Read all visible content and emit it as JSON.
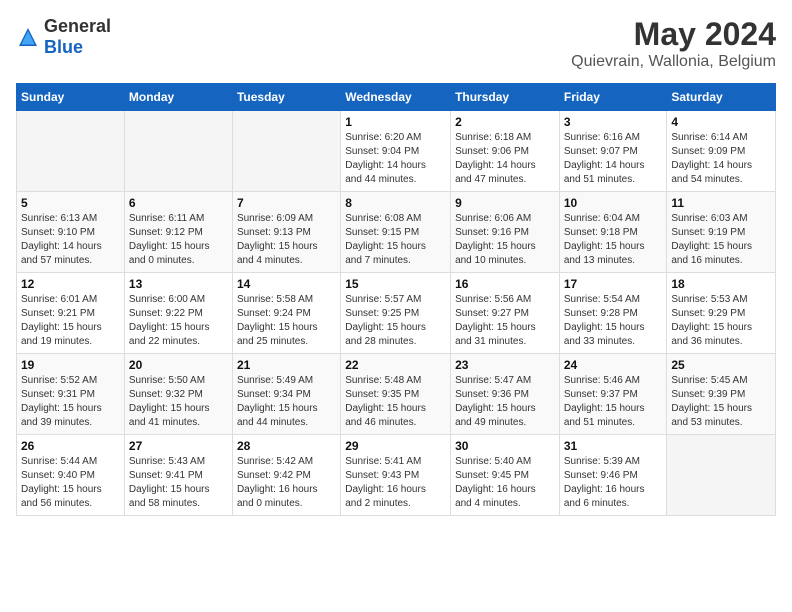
{
  "header": {
    "logo_general": "General",
    "logo_blue": "Blue",
    "title": "May 2024",
    "subtitle": "Quievrain, Wallonia, Belgium"
  },
  "calendar": {
    "days_of_week": [
      "Sunday",
      "Monday",
      "Tuesday",
      "Wednesday",
      "Thursday",
      "Friday",
      "Saturday"
    ],
    "weeks": [
      [
        {
          "day": "",
          "info": ""
        },
        {
          "day": "",
          "info": ""
        },
        {
          "day": "",
          "info": ""
        },
        {
          "day": "1",
          "info": "Sunrise: 6:20 AM\nSunset: 9:04 PM\nDaylight: 14 hours\nand 44 minutes."
        },
        {
          "day": "2",
          "info": "Sunrise: 6:18 AM\nSunset: 9:06 PM\nDaylight: 14 hours\nand 47 minutes."
        },
        {
          "day": "3",
          "info": "Sunrise: 6:16 AM\nSunset: 9:07 PM\nDaylight: 14 hours\nand 51 minutes."
        },
        {
          "day": "4",
          "info": "Sunrise: 6:14 AM\nSunset: 9:09 PM\nDaylight: 14 hours\nand 54 minutes."
        }
      ],
      [
        {
          "day": "5",
          "info": "Sunrise: 6:13 AM\nSunset: 9:10 PM\nDaylight: 14 hours\nand 57 minutes."
        },
        {
          "day": "6",
          "info": "Sunrise: 6:11 AM\nSunset: 9:12 PM\nDaylight: 15 hours\nand 0 minutes."
        },
        {
          "day": "7",
          "info": "Sunrise: 6:09 AM\nSunset: 9:13 PM\nDaylight: 15 hours\nand 4 minutes."
        },
        {
          "day": "8",
          "info": "Sunrise: 6:08 AM\nSunset: 9:15 PM\nDaylight: 15 hours\nand 7 minutes."
        },
        {
          "day": "9",
          "info": "Sunrise: 6:06 AM\nSunset: 9:16 PM\nDaylight: 15 hours\nand 10 minutes."
        },
        {
          "day": "10",
          "info": "Sunrise: 6:04 AM\nSunset: 9:18 PM\nDaylight: 15 hours\nand 13 minutes."
        },
        {
          "day": "11",
          "info": "Sunrise: 6:03 AM\nSunset: 9:19 PM\nDaylight: 15 hours\nand 16 minutes."
        }
      ],
      [
        {
          "day": "12",
          "info": "Sunrise: 6:01 AM\nSunset: 9:21 PM\nDaylight: 15 hours\nand 19 minutes."
        },
        {
          "day": "13",
          "info": "Sunrise: 6:00 AM\nSunset: 9:22 PM\nDaylight: 15 hours\nand 22 minutes."
        },
        {
          "day": "14",
          "info": "Sunrise: 5:58 AM\nSunset: 9:24 PM\nDaylight: 15 hours\nand 25 minutes."
        },
        {
          "day": "15",
          "info": "Sunrise: 5:57 AM\nSunset: 9:25 PM\nDaylight: 15 hours\nand 28 minutes."
        },
        {
          "day": "16",
          "info": "Sunrise: 5:56 AM\nSunset: 9:27 PM\nDaylight: 15 hours\nand 31 minutes."
        },
        {
          "day": "17",
          "info": "Sunrise: 5:54 AM\nSunset: 9:28 PM\nDaylight: 15 hours\nand 33 minutes."
        },
        {
          "day": "18",
          "info": "Sunrise: 5:53 AM\nSunset: 9:29 PM\nDaylight: 15 hours\nand 36 minutes."
        }
      ],
      [
        {
          "day": "19",
          "info": "Sunrise: 5:52 AM\nSunset: 9:31 PM\nDaylight: 15 hours\nand 39 minutes."
        },
        {
          "day": "20",
          "info": "Sunrise: 5:50 AM\nSunset: 9:32 PM\nDaylight: 15 hours\nand 41 minutes."
        },
        {
          "day": "21",
          "info": "Sunrise: 5:49 AM\nSunset: 9:34 PM\nDaylight: 15 hours\nand 44 minutes."
        },
        {
          "day": "22",
          "info": "Sunrise: 5:48 AM\nSunset: 9:35 PM\nDaylight: 15 hours\nand 46 minutes."
        },
        {
          "day": "23",
          "info": "Sunrise: 5:47 AM\nSunset: 9:36 PM\nDaylight: 15 hours\nand 49 minutes."
        },
        {
          "day": "24",
          "info": "Sunrise: 5:46 AM\nSunset: 9:37 PM\nDaylight: 15 hours\nand 51 minutes."
        },
        {
          "day": "25",
          "info": "Sunrise: 5:45 AM\nSunset: 9:39 PM\nDaylight: 15 hours\nand 53 minutes."
        }
      ],
      [
        {
          "day": "26",
          "info": "Sunrise: 5:44 AM\nSunset: 9:40 PM\nDaylight: 15 hours\nand 56 minutes."
        },
        {
          "day": "27",
          "info": "Sunrise: 5:43 AM\nSunset: 9:41 PM\nDaylight: 15 hours\nand 58 minutes."
        },
        {
          "day": "28",
          "info": "Sunrise: 5:42 AM\nSunset: 9:42 PM\nDaylight: 16 hours\nand 0 minutes."
        },
        {
          "day": "29",
          "info": "Sunrise: 5:41 AM\nSunset: 9:43 PM\nDaylight: 16 hours\nand 2 minutes."
        },
        {
          "day": "30",
          "info": "Sunrise: 5:40 AM\nSunset: 9:45 PM\nDaylight: 16 hours\nand 4 minutes."
        },
        {
          "day": "31",
          "info": "Sunrise: 5:39 AM\nSunset: 9:46 PM\nDaylight: 16 hours\nand 6 minutes."
        },
        {
          "day": "",
          "info": ""
        }
      ]
    ]
  }
}
